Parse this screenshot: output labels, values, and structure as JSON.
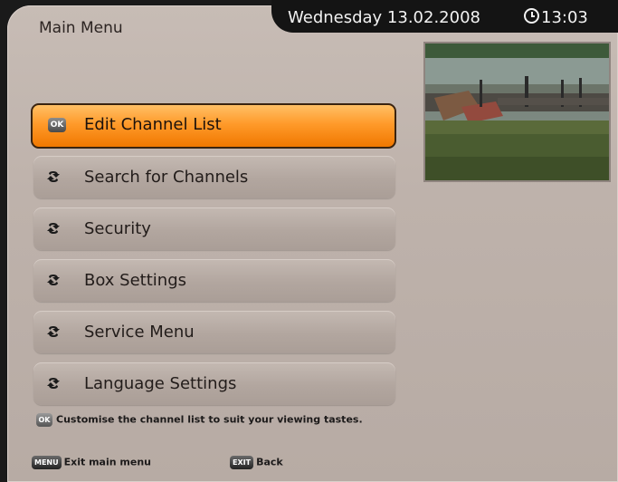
{
  "header": {
    "title": "Main Menu",
    "date": "Wednesday 13.02.2008",
    "time": "13:03"
  },
  "menu": {
    "items": [
      {
        "label": "Edit Channel List",
        "icon": "ok-badge-icon",
        "active": true,
        "badge": "OK"
      },
      {
        "label": "Search for Channels",
        "icon": "arrow-icon",
        "active": false
      },
      {
        "label": "Security",
        "icon": "arrow-icon",
        "active": false
      },
      {
        "label": "Box Settings",
        "icon": "arrow-icon",
        "active": false
      },
      {
        "label": "Service Menu",
        "icon": "arrow-icon",
        "active": false
      },
      {
        "label": "Language Settings",
        "icon": "arrow-icon",
        "active": false
      }
    ]
  },
  "hint": {
    "badge": "OK",
    "text": "Customise the channel list to suit your viewing tastes."
  },
  "footer": {
    "menu_key": "MENU",
    "menu_label": "Exit main menu",
    "exit_key": "EXIT",
    "exit_label": "Back"
  },
  "colors": {
    "active_item": "#ff9a2a",
    "panel": "#beb2ab",
    "topbar": "#141414"
  }
}
